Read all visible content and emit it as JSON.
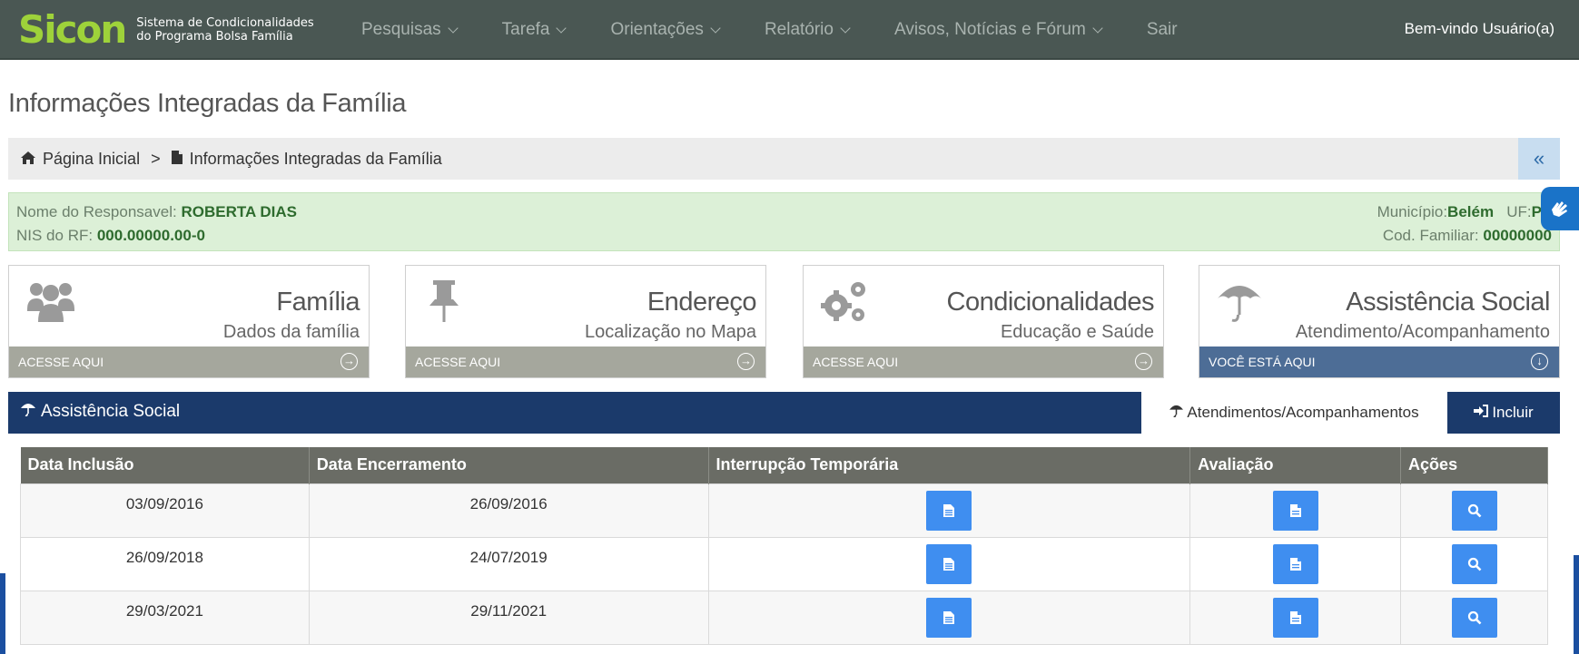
{
  "navbar": {
    "logo_text": "Sicon",
    "logo_sub_line1": "Sistema de Condicionalidades",
    "logo_sub_line2": "do Programa Bolsa Família",
    "menu": [
      {
        "label": "Pesquisas"
      },
      {
        "label": "Tarefa"
      },
      {
        "label": "Orientações"
      },
      {
        "label": "Relatório"
      },
      {
        "label": "Avisos, Notícias e Fórum"
      }
    ],
    "sair": "Sair",
    "welcome": "Bem-vindo Usuário(a)"
  },
  "page_title": "Informações Integradas da Família",
  "breadcrumb": {
    "home": "Página Inicial",
    "separator": ">",
    "current": "Informações Integradas da Família",
    "collapse": "«"
  },
  "info": {
    "responsavel_label": "Nome do Responsavel:",
    "responsavel_value": "ROBERTA DIAS",
    "nis_label": "NIS do RF:",
    "nis_value": "000.00000.00-0",
    "municipio_label": "Município:",
    "municipio_value": "Belém",
    "uf_label": "UF:",
    "uf_value": "PA",
    "cod_label": "Cod. Familiar:",
    "cod_value": "00000000"
  },
  "cards": [
    {
      "title": "Família",
      "subtitle": "Dados da família",
      "bar": "ACESSE AQUI",
      "icon": "users-icon"
    },
    {
      "title": "Endereço",
      "subtitle": "Localização no Mapa",
      "bar": "ACESSE AQUI",
      "icon": "pushpin-icon"
    },
    {
      "title": "Condicionalidades",
      "subtitle": "Educação e Saúde",
      "bar": "ACESSE AQUI",
      "icon": "gears-icon"
    },
    {
      "title": "Assistência Social",
      "subtitle": "Atendimento/Acompanhamento",
      "bar": "VOCÊ ESTÁ AQUI",
      "icon": "umbrella-icon"
    }
  ],
  "section": {
    "title": "Assistência Social",
    "tab_active": "Atendimentos/Acompanhamentos",
    "tab_incluir": "Incluir"
  },
  "table": {
    "headers": [
      "Data Inclusão",
      "Data Encerramento",
      "Interrupção Temporária",
      "Avaliação",
      "Ações"
    ],
    "rows": [
      {
        "inclusao": "03/09/2016",
        "encerramento": "26/09/2016"
      },
      {
        "inclusao": "26/09/2018",
        "encerramento": "24/07/2019"
      },
      {
        "inclusao": "29/03/2021",
        "encerramento": "29/11/2021"
      }
    ]
  },
  "colors": {
    "navbar": "#4a5753",
    "logo": "#9ed23a",
    "section": "#1b3a6b",
    "button": "#3f8ef0",
    "active_card_bar": "#4d6d96"
  }
}
